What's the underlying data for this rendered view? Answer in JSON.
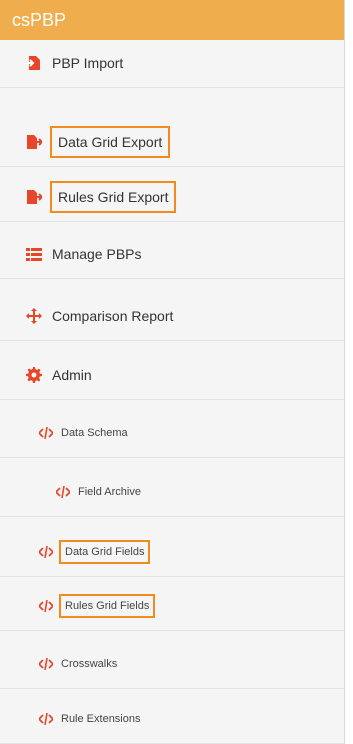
{
  "app_title": "csPBP",
  "colors": {
    "header_bg": "#f0ad4e",
    "icon": "#e8462b",
    "highlight_border": "#f28a1e"
  },
  "menu": [
    {
      "label": "PBP Import",
      "icon": "file-import-icon",
      "highlighted": false
    },
    {
      "label": "Data Grid Export",
      "icon": "file-export-icon",
      "highlighted": true
    },
    {
      "label": "Rules Grid Export",
      "icon": "file-export-icon",
      "highlighted": true
    },
    {
      "label": "Manage PBPs",
      "icon": "list-icon",
      "highlighted": false
    },
    {
      "label": "Comparison Report",
      "icon": "arrows-move-icon",
      "highlighted": false
    },
    {
      "label": "Admin",
      "icon": "gear-icon",
      "highlighted": false
    },
    {
      "label": "Data Schema",
      "icon": "code-icon",
      "highlighted": false
    },
    {
      "label": "Field Archive",
      "icon": "code-icon",
      "highlighted": false
    },
    {
      "label": "Data Grid Fields",
      "icon": "code-icon",
      "highlighted": true
    },
    {
      "label": "Rules Grid Fields",
      "icon": "code-icon",
      "highlighted": true
    },
    {
      "label": "Crosswalks",
      "icon": "code-icon",
      "highlighted": false
    },
    {
      "label": "Rule Extensions",
      "icon": "code-icon",
      "highlighted": false
    }
  ]
}
